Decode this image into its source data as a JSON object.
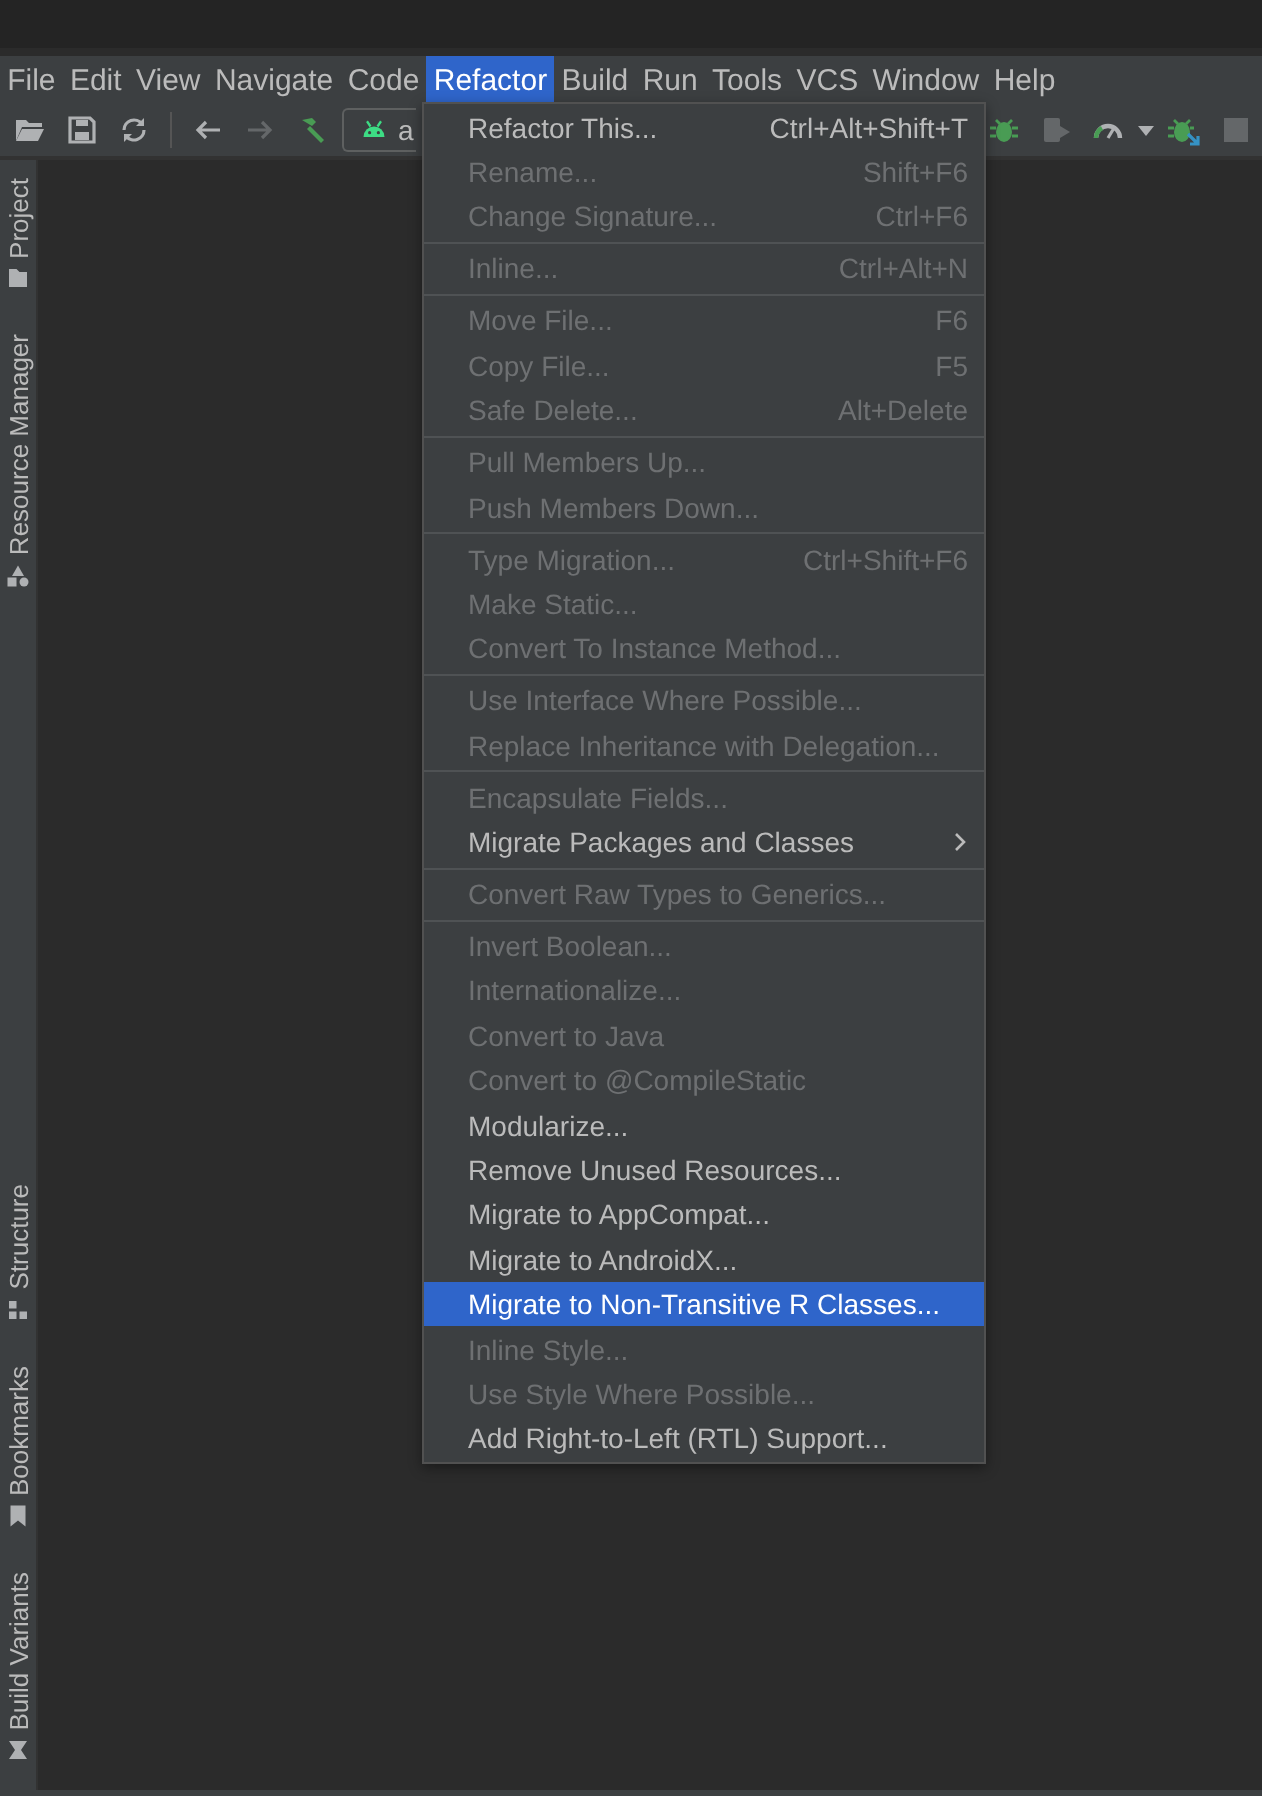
{
  "menu_bar": [
    {
      "label": "File",
      "selected": false
    },
    {
      "label": "Edit",
      "selected": false
    },
    {
      "label": "View",
      "selected": false
    },
    {
      "label": "Navigate",
      "selected": false
    },
    {
      "label": "Code",
      "selected": false
    },
    {
      "label": "Refactor",
      "selected": true
    },
    {
      "label": "Build",
      "selected": false
    },
    {
      "label": "Run",
      "selected": false
    },
    {
      "label": "Tools",
      "selected": false
    },
    {
      "label": "VCS",
      "selected": false
    },
    {
      "label": "Window",
      "selected": false
    },
    {
      "label": "Help",
      "selected": false
    }
  ],
  "toolbar": {
    "left": [
      {
        "kind": "open",
        "disabled": false
      },
      {
        "kind": "save",
        "disabled": false
      },
      {
        "kind": "sync",
        "disabled": false
      }
    ],
    "nav": [
      {
        "kind": "back",
        "disabled": false
      },
      {
        "kind": "forward",
        "disabled": true
      },
      {
        "kind": "build",
        "disabled": false
      }
    ],
    "run_config": "a",
    "right": [
      {
        "kind": "debug",
        "disabled": false
      },
      {
        "kind": "attach",
        "disabled": true
      },
      {
        "kind": "profile",
        "disabled": false
      },
      {
        "kind": "caret",
        "disabled": false
      },
      {
        "kind": "apply",
        "disabled": false
      },
      {
        "kind": "stop",
        "disabled": true
      }
    ]
  },
  "tool_windows": {
    "top": [
      {
        "label": "Project",
        "kind": "folder"
      },
      {
        "label": "Resource Manager",
        "kind": "shapes"
      }
    ],
    "bottom": [
      {
        "label": "Structure",
        "kind": "structure"
      },
      {
        "label": "Bookmarks",
        "kind": "bookmark"
      },
      {
        "label": "Build Variants",
        "kind": "variants"
      }
    ]
  },
  "refactor_menu": {
    "groups": [
      [
        {
          "label": "Refactor This...",
          "shortcut": "Ctrl+Alt+Shift+T",
          "kind": "action",
          "disabled": false,
          "selected": false
        },
        {
          "label": "Rename...",
          "shortcut": "Shift+F6",
          "kind": "action",
          "disabled": true,
          "selected": false
        },
        {
          "label": "Change Signature...",
          "shortcut": "Ctrl+F6",
          "kind": "action",
          "disabled": true,
          "selected": false
        }
      ],
      [
        {
          "label": "Inline...",
          "shortcut": "Ctrl+Alt+N",
          "kind": "action",
          "disabled": true,
          "selected": false
        }
      ],
      [
        {
          "label": "Move File...",
          "shortcut": "F6",
          "kind": "action",
          "disabled": true,
          "selected": false
        },
        {
          "label": "Copy File...",
          "shortcut": "F5",
          "kind": "action",
          "disabled": true,
          "selected": false
        },
        {
          "label": "Safe Delete...",
          "shortcut": "Alt+Delete",
          "kind": "action",
          "disabled": true,
          "selected": false
        }
      ],
      [
        {
          "label": "Pull Members Up...",
          "kind": "action",
          "disabled": true,
          "selected": false
        },
        {
          "label": "Push Members Down...",
          "kind": "action",
          "disabled": true,
          "selected": false
        }
      ],
      [
        {
          "label": "Type Migration...",
          "shortcut": "Ctrl+Shift+F6",
          "kind": "action",
          "disabled": true,
          "selected": false
        },
        {
          "label": "Make Static...",
          "kind": "action",
          "disabled": true,
          "selected": false
        },
        {
          "label": "Convert To Instance Method...",
          "kind": "action",
          "disabled": true,
          "selected": false
        }
      ],
      [
        {
          "label": "Use Interface Where Possible...",
          "kind": "action",
          "disabled": true,
          "selected": false
        },
        {
          "label": "Replace Inheritance with Delegation...",
          "kind": "action",
          "disabled": true,
          "selected": false
        }
      ],
      [
        {
          "label": "Encapsulate Fields...",
          "kind": "action",
          "disabled": true,
          "selected": false
        },
        {
          "label": "Migrate Packages and Classes",
          "kind": "submenu",
          "disabled": false,
          "selected": false
        }
      ],
      [
        {
          "label": "Convert Raw Types to Generics...",
          "kind": "action",
          "disabled": true,
          "selected": false
        }
      ],
      [
        {
          "label": "Invert Boolean...",
          "kind": "action",
          "disabled": true,
          "selected": false
        },
        {
          "label": "Internationalize...",
          "kind": "action",
          "disabled": true,
          "selected": false
        },
        {
          "label": "Convert to Java",
          "kind": "action",
          "disabled": true,
          "selected": false
        },
        {
          "label": "Convert to @CompileStatic",
          "kind": "action",
          "disabled": true,
          "selected": false
        },
        {
          "label": "Modularize...",
          "kind": "action",
          "disabled": false,
          "selected": false
        },
        {
          "label": "Remove Unused Resources...",
          "kind": "action",
          "disabled": false,
          "selected": false
        },
        {
          "label": "Migrate to AppCompat...",
          "kind": "action",
          "disabled": false,
          "selected": false
        },
        {
          "label": "Migrate to AndroidX...",
          "kind": "action",
          "disabled": false,
          "selected": false
        },
        {
          "label": "Migrate to Non-Transitive R Classes...",
          "kind": "action",
          "disabled": false,
          "selected": true
        },
        {
          "label": "Inline Style...",
          "kind": "action",
          "disabled": true,
          "selected": false
        },
        {
          "label": "Use Style Where Possible...",
          "kind": "action",
          "disabled": true,
          "selected": false
        },
        {
          "label": "Add Right-to-Left (RTL) Support...",
          "kind": "action",
          "disabled": false,
          "selected": false
        }
      ]
    ]
  }
}
